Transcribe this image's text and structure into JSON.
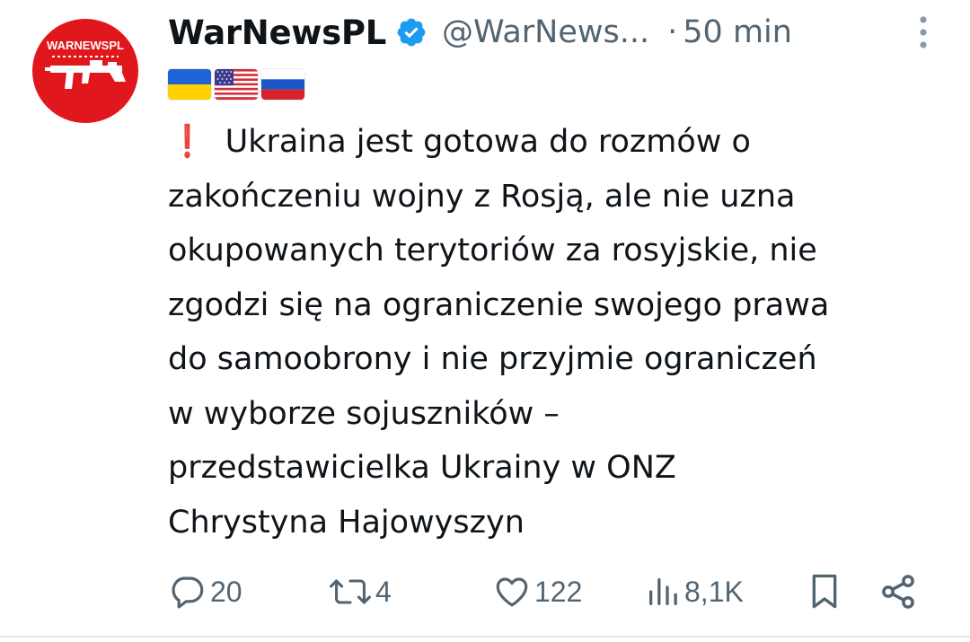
{
  "post": {
    "display_name": "WarNewsPL",
    "handle": "@WarNews...",
    "separator": "·",
    "time": "50 min",
    "avatar_text": "WARNEWSPL",
    "flags": [
      "ukraine-flag",
      "usa-flag",
      "russia-flag"
    ],
    "text_lines": [
      "Ukraina jest gotowa do rozmów o",
      "zakończeniu wojny z Rosją, ale nie uzna",
      "okupowanych terytoriów za rosyjskie, nie",
      "zgodzi się na ograniczenie swojego prawa",
      "do samoobrony i nie przyjmie ograniczeń",
      "w wyborze sojuszników –",
      "przedstawicielka Ukrainy w ONZ",
      "Chrystyna Hajowyszyn"
    ],
    "exclamation_emoji": "❗"
  },
  "actions": {
    "replies": "20",
    "reposts": "4",
    "likes": "122",
    "views": "8,1K"
  },
  "colors": {
    "avatar_red": "#e0181d",
    "verified_blue": "#1d9bf0",
    "muted": "#536471",
    "exclaim_red": "#e11d48"
  }
}
